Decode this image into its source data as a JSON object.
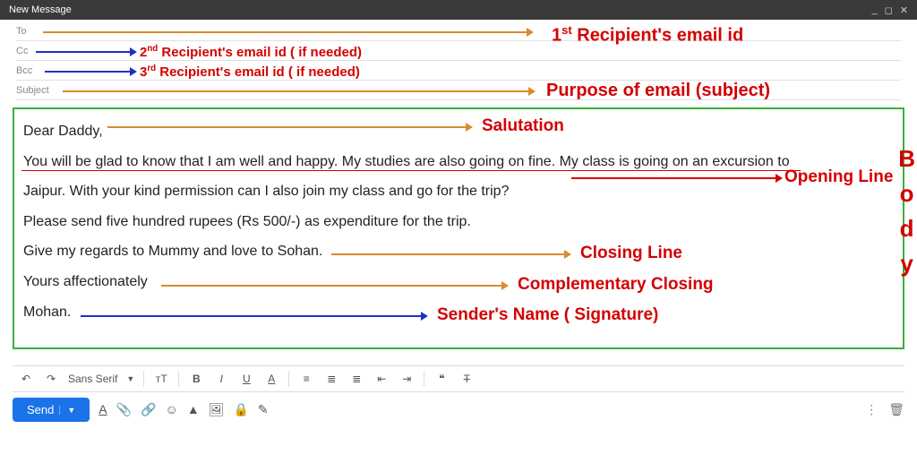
{
  "titlebar": {
    "title": "New Message"
  },
  "fields": {
    "to": "To",
    "cc": "Cc",
    "bcc": "Bcc",
    "subject": "Subject"
  },
  "annotations": {
    "recipient1_prefix": "1",
    "recipient1_sup": "st",
    "recipient1_rest": " Recipient's email id",
    "recipient2_prefix": "2",
    "recipient2_sup": "nd",
    "recipient2_rest": " Recipient's email id ( if needed)",
    "recipient3_prefix": "3",
    "recipient3_sup": "rd",
    "recipient3_rest": " Recipient's email id ( if needed)",
    "subject": "Purpose of email (subject)",
    "salutation": "Salutation",
    "opening": "Opening Line",
    "closing": "Closing Line",
    "complementary": "Complementary Closing",
    "signature": "Sender's Name ( Signature)",
    "body_b": "B",
    "body_o": "o",
    "body_d": "d",
    "body_y": "y"
  },
  "body": {
    "salutation": "Dear Daddy,",
    "p1": "You will be glad to know that I am well and happy. My studies are also going on fine. My class is going on an excursion to",
    "p2": "Jaipur. With your kind permission can I also join my class and go for the trip?",
    "p3": "Please send five hundred rupees (Rs 500/-) as expenditure for the trip.",
    "p4": "Give my regards to Mummy and love to Sohan.",
    "closing": "Yours affectionately",
    "signature": "Mohan."
  },
  "toolbar": {
    "font": "Sans Serif",
    "send": "Send"
  }
}
